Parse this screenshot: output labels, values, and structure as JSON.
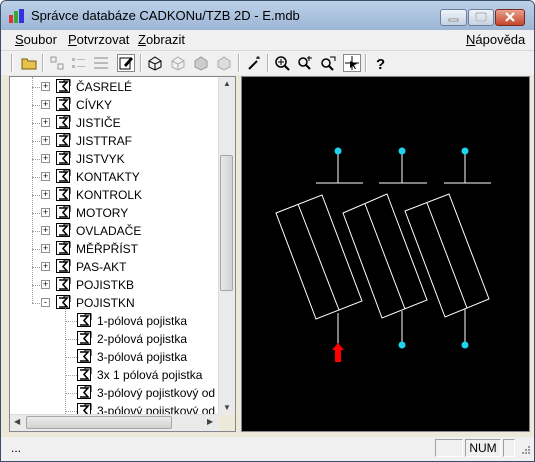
{
  "window": {
    "title": "Správce databáze CADKONu/TZB 2D - E.mdb"
  },
  "menu": {
    "items": [
      {
        "label": "Soubor",
        "underline": "S"
      },
      {
        "label": "Potvrzovat",
        "underline": "P"
      },
      {
        "label": "Zobrazit",
        "underline": "Z"
      }
    ],
    "help": {
      "label": "Nápověda",
      "underline": "N"
    }
  },
  "toolbar": {
    "icons": [
      "open-folder-icon",
      "list-large-icon",
      "list-small-icon",
      "list-details-icon",
      "edit-icon",
      "box-3d-icon",
      "box-3d-alt-icon",
      "box-shaded-icon",
      "box-render-icon",
      "magic-wand-icon",
      "zoom-window-icon",
      "zoom-in-icon",
      "zoom-realtime-icon",
      "select-icon",
      "help-icon"
    ]
  },
  "tree": {
    "items": [
      {
        "label": "ČASRELÉ",
        "level": 1,
        "expander": "+"
      },
      {
        "label": "CÍVKY",
        "level": 1,
        "expander": "+"
      },
      {
        "label": "JISTIČE",
        "level": 1,
        "expander": "+"
      },
      {
        "label": "JISTTRAF",
        "level": 1,
        "expander": "+"
      },
      {
        "label": "JISTVYK",
        "level": 1,
        "expander": "+"
      },
      {
        "label": "KONTAKTY",
        "level": 1,
        "expander": "+"
      },
      {
        "label": "KONTROLK",
        "level": 1,
        "expander": "+"
      },
      {
        "label": "MOTORY",
        "level": 1,
        "expander": "+"
      },
      {
        "label": "OVLADAČE",
        "level": 1,
        "expander": "+"
      },
      {
        "label": "MĚŘPŘÍST",
        "level": 1,
        "expander": "+"
      },
      {
        "label": "PAS-AKT",
        "level": 1,
        "expander": "+"
      },
      {
        "label": "POJISTKB",
        "level": 1,
        "expander": "+"
      },
      {
        "label": "POJISTKN",
        "level": 1,
        "expander": "-"
      },
      {
        "label": "1-pólová pojistka",
        "level": 2
      },
      {
        "label": "2-pólová pojistka",
        "level": 2
      },
      {
        "label": "3-pólová pojistka",
        "level": 2
      },
      {
        "label": "3x 1 pólová pojistka",
        "level": 2
      },
      {
        "label": "3-pólový pojistkový od",
        "level": 2
      },
      {
        "label": "3-pólový pojistkový od",
        "level": 2
      }
    ]
  },
  "status": {
    "message": "...",
    "num": "NUM"
  },
  "colors": {
    "canvas_bg": "#000000",
    "drawing": "#ffffff",
    "node": "#1fd2f0",
    "insert_arrow": "#ff0000"
  }
}
